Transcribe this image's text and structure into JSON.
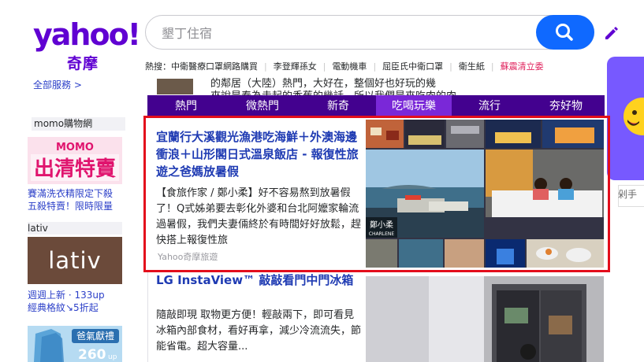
{
  "search": {
    "placeholder": "墾丁住宿"
  },
  "logo": {
    "word": "yahoo!",
    "sub": "奇摩"
  },
  "hot_searches": {
    "label": "熱搜：",
    "items": [
      "中衛醫療口罩網路購買",
      "李登輝孫女",
      "電動機車",
      "屈臣氏中衛口罩",
      "衛生紙",
      "蘇震清立委"
    ]
  },
  "sidebar": {
    "all_services": "全部服務 >",
    "momo": {
      "label": "momo購物網",
      "img_top": "MOMO",
      "img_main": "出清特賣",
      "link_line1": "賽滿洗衣精限定下殺",
      "link_line2": "五殺特賣！限時限量"
    },
    "lativ": {
      "label": "lativ",
      "img_text": "lativ",
      "link_line1": "週週上新 · 133up",
      "link_line2": "經典格紋↘5折起"
    },
    "ad3": {
      "img_text": "爸氣獻禮",
      "price": "260",
      "unit": "up"
    }
  },
  "strip": {
    "line1": "的鄰居（大陸）熱門，大好在，整個好也好玩的幾",
    "line2": "來說是春為走起的香蕉的幾話，所以我們是來吃肉的肉"
  },
  "tabs": [
    {
      "label": "熱門",
      "active": false
    },
    {
      "label": "微熱門",
      "active": false
    },
    {
      "label": "新奇",
      "active": false
    },
    {
      "label": "吃喝玩樂",
      "active": true
    },
    {
      "label": "流行",
      "active": false
    },
    {
      "label": "夯好物",
      "active": false
    }
  ],
  "feature": {
    "title": "宜蘭行大溪觀光漁港吃海鮮＋外澳海邊衝浪＋山形閣日式溫泉飯店 - 報復性旅遊之爸媽放暑假",
    "summary": "【食旅作家 / 鄭小柔】好不容易熬到放暑假了！Q式姊弟要去彰化外婆和台北阿嬤家輪流過暑假，我們夫妻倆終於有時間好好放鬆，趕快搭上報復性旅",
    "source": "Yahoo奇摩旅遊",
    "watermark": "鄭小柔",
    "watermark_sub": "CHARLENE"
  },
  "story2": {
    "title": "LG InstaView™ 敲敲看門中門冰箱",
    "summary": "隨敲即現 取物更方便！輕敲兩下，即可看見冰箱內部食材，看好再拿，減少冷流流失，節能省電。超大容量..."
  },
  "right_col": {
    "text": "剁手"
  },
  "colors": {
    "brand": "#6001d2",
    "tab_bg": "#43018f",
    "tab_active": "#7a28d8",
    "search_button": "#0f69ff",
    "highlight": "#e30e1c",
    "link": "#1f3bb3"
  }
}
